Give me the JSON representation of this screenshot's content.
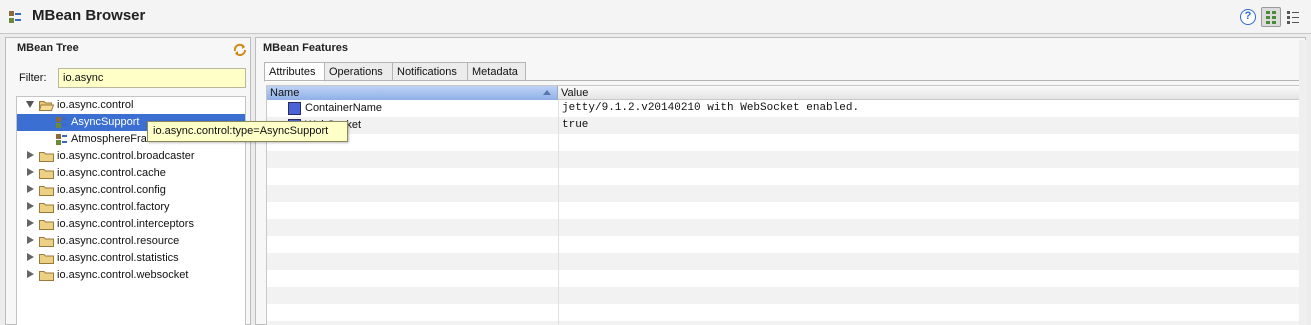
{
  "header": {
    "title": "MBean Browser",
    "help_label": "?"
  },
  "tree_panel": {
    "title": "MBean Tree",
    "filter_label": "Filter:",
    "filter_value": "io.async",
    "items": [
      {
        "label": "io.async.control",
        "expanded": true
      },
      {
        "label": "AsyncSupport",
        "selected": true
      },
      {
        "label": "AtmosphereFramework"
      },
      {
        "label": "io.async.control.broadcaster"
      },
      {
        "label": "io.async.control.cache"
      },
      {
        "label": "io.async.control.config"
      },
      {
        "label": "io.async.control.factory"
      },
      {
        "label": "io.async.control.interceptors"
      },
      {
        "label": "io.async.control.resource"
      },
      {
        "label": "io.async.control.statistics"
      },
      {
        "label": "io.async.control.websocket"
      }
    ],
    "tooltip": "io.async.control:type=AsyncSupport"
  },
  "features_panel": {
    "title": "MBean Features",
    "tabs": [
      "Attributes",
      "Operations",
      "Notifications",
      "Metadata"
    ],
    "active_tab": "Attributes",
    "columns": [
      "Name",
      "Value"
    ],
    "rows": [
      {
        "name": "ContainerName",
        "value": "jetty/9.1.2.v20140210 with WebSocket enabled."
      },
      {
        "name": "WebSocket",
        "value": "true"
      }
    ]
  },
  "colors": {
    "selection": "#3c6fd2",
    "tooltip_bg": "#ffffc8",
    "attribute_icon": "#4b63d8"
  }
}
